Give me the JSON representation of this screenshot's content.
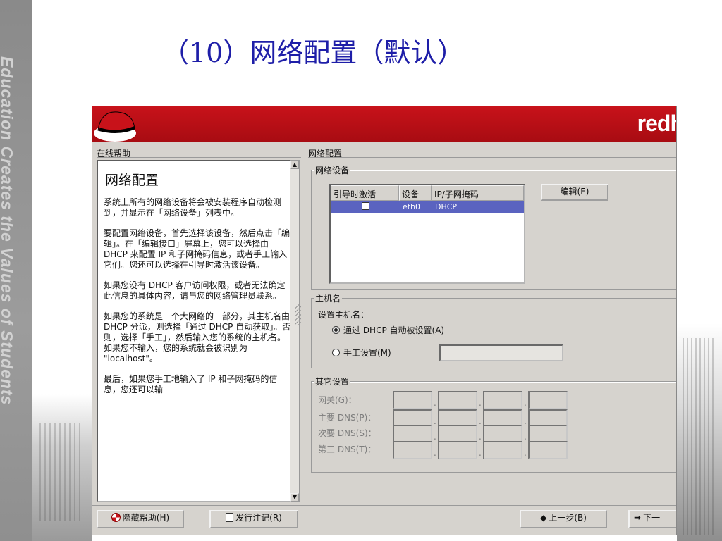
{
  "slide": {
    "title": "（10）网络配置（默认）",
    "side_text": "Education Creates the Values of Students"
  },
  "window": {
    "brand": "redh",
    "help": {
      "label": "在线帮助",
      "heading": "网络配置",
      "paragraphs": [
        "系统上所有的网络设备将会被安装程序自动检测到，并显示在「网络设备」列表中。",
        "要配置网络设备，首先选择该设备，然后点击「编辑」。在「编辑接口」屏幕上，您可以选择由 DHCP 来配置 IP 和子网掩码信息，或者手工输入它们。您还可以选择在引导时激活该设备。",
        "如果您没有 DHCP 客户访问权限，或者无法确定此信息的具体内容，请与您的网络管理员联系。",
        "如果您的系统是一个大网络的一部分，其主机名由 DHCP 分派，则选择「通过 DHCP 自动获取」。否则，选择「手工」，然后输入您的系统的主机名。如果您不输入，您的系统就会被识别为 \"localhost\"。",
        "最后，如果您手工地输入了 IP 和子网掩码的信息，您还可以输"
      ]
    },
    "network": {
      "section_label": "网络配置",
      "devices": {
        "title": "网络设备",
        "columns": [
          "引导时激活",
          "设备",
          "IP/子网掩码"
        ],
        "rows": [
          {
            "active": "✓",
            "device": "eth0",
            "ip": "DHCP"
          }
        ],
        "edit_button": "编辑(E)"
      },
      "hostname": {
        "title": "主机名",
        "set_label": "设置主机名：",
        "option_dhcp": "通过 DHCP 自动被设置(A)",
        "option_manual": "手工设置(M)",
        "manual_value": ""
      },
      "other": {
        "title": "其它设置",
        "gateway": "网关(G)：",
        "dns1": "主要 DNS(P)：",
        "dns2": "次要 DNS(S)：",
        "dns3": "第三 DNS(T)："
      }
    },
    "buttons": {
      "hide_help": "隐藏帮助(H)",
      "release_notes": "发行注记(R)",
      "back": "上一步(B)",
      "next": "下一"
    }
  }
}
